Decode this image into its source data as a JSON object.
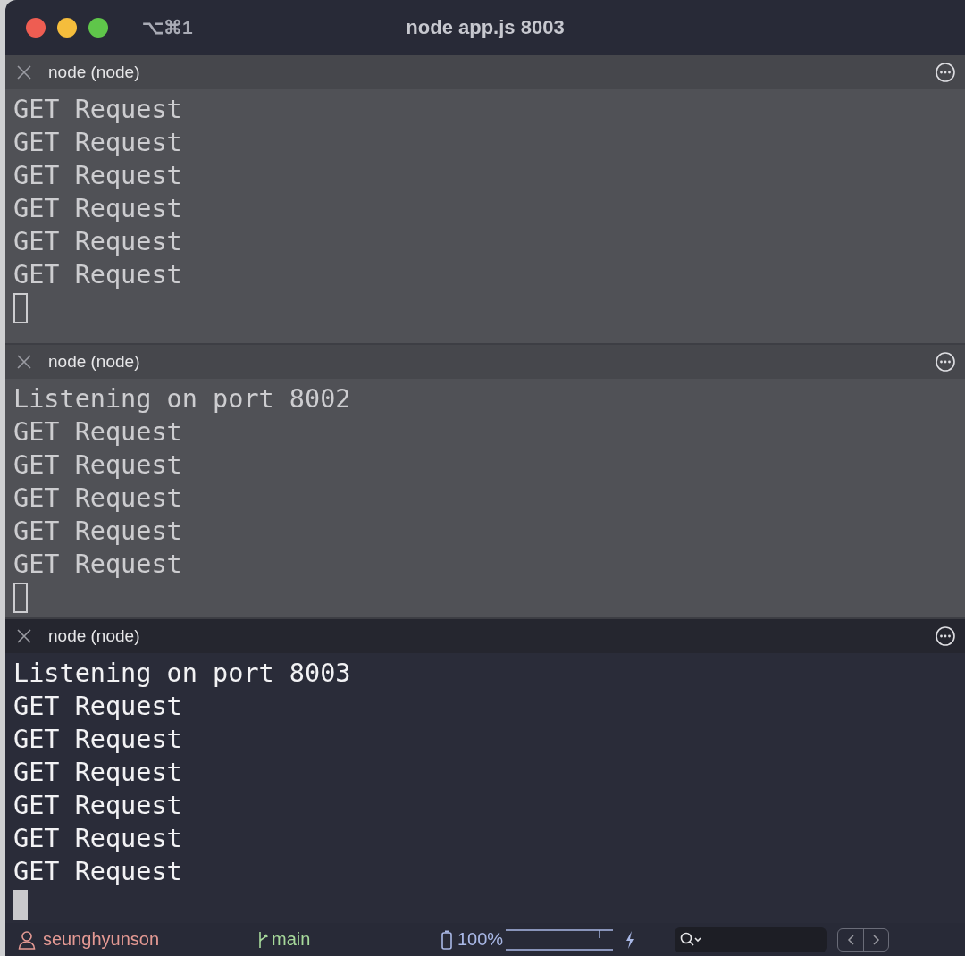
{
  "window": {
    "title": "node app.js 8003",
    "shortcut": "⌥⌘1"
  },
  "panes": [
    {
      "title": "node (node)",
      "active": false,
      "lines": [
        "GET Request",
        "GET Request",
        "GET Request",
        "GET Request",
        "GET Request",
        "GET Request"
      ]
    },
    {
      "title": "node (node)",
      "active": false,
      "lines": [
        "Listening on port 8002",
        "GET Request",
        "GET Request",
        "GET Request",
        "GET Request",
        "GET Request"
      ]
    },
    {
      "title": "node (node)",
      "active": true,
      "lines": [
        "Listening on port 8003",
        "GET Request",
        "GET Request",
        "GET Request",
        "GET Request",
        "GET Request",
        "GET Request"
      ]
    }
  ],
  "status_bar": {
    "user": "seunghyunson",
    "branch": "main",
    "battery": "100%"
  }
}
